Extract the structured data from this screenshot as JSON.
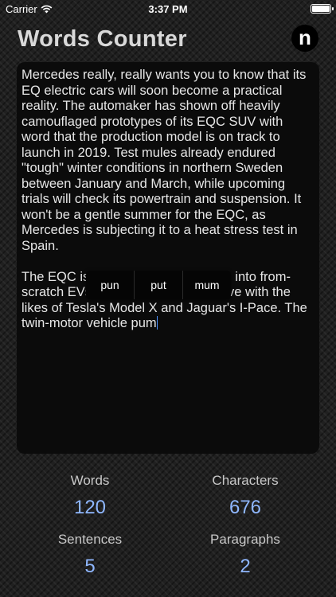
{
  "status_bar": {
    "carrier": "Carrier",
    "time": "3:37 PM"
  },
  "header": {
    "title": "Words Counter",
    "logo_letter": "n"
  },
  "editor": {
    "paragraph1": "Mercedes really, really wants you to know that its EQ electric cars will soon become a practical reality. The automaker has shown off heavily camouflaged prototypes of its EQC SUV with word that the production model is on track to launch in 2019. Test mules already endured \"tough\" winter conditions in northern Sweden between January and March, while upcoming trials will check its powertrain and suspension. It won't be a gentle summer for the EQC, as Mercedes is subjecting it to a heat stress test in Spain.",
    "paragraph2_line1_start": "The EQC is",
    "paragraph2_line1_end": "into from-",
    "paragraph2_line2_start": "scratch EVs",
    "paragraph2_line2_end": "ve with the",
    "paragraph2_rest": "likes of Tesla's Model X and Jaguar's I-Pace. The twin-motor vehicle pum"
  },
  "suggestions": [
    "pun",
    "put",
    "mum"
  ],
  "stats": {
    "words": {
      "label": "Words",
      "value": "120"
    },
    "characters": {
      "label": "Characters",
      "value": "676"
    },
    "sentences": {
      "label": "Sentences",
      "value": "5"
    },
    "paragraphs": {
      "label": "Paragraphs",
      "value": "2"
    }
  },
  "colors": {
    "accent": "#8fb7ff",
    "cursor": "#4a90ff"
  }
}
